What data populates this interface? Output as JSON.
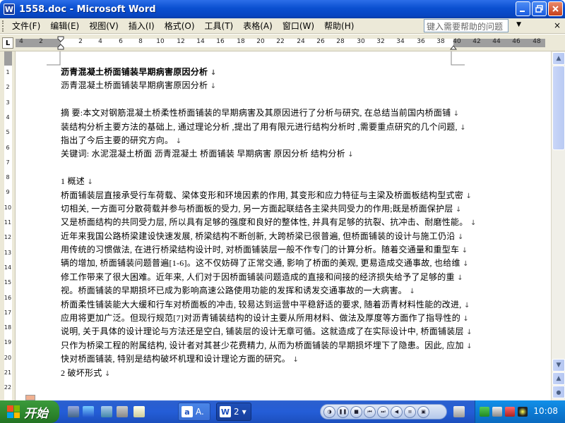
{
  "window": {
    "title": "1558.doc - Microsoft Word",
    "app_icon": "W",
    "buttons": [
      "minimize",
      "maximize",
      "close"
    ]
  },
  "menubar": {
    "items": [
      "文件(F)",
      "编辑(E)",
      "视图(V)",
      "插入(I)",
      "格式(O)",
      "工具(T)",
      "表格(A)",
      "窗口(W)",
      "帮助(H)"
    ],
    "help_placeholder": "键入需要帮助的问题",
    "close_glyph": "×"
  },
  "ruler": {
    "tab_selector": "L",
    "numbers": [
      "4",
      "2",
      "2",
      "4",
      "6",
      "8",
      "10",
      "12",
      "14",
      "16",
      "18",
      "20",
      "22",
      "24",
      "26",
      "28",
      "30",
      "32",
      "34",
      "36",
      "38",
      "40",
      "42",
      "44",
      "46",
      "48"
    ],
    "vertical_numbers": [
      "1",
      "2",
      "3",
      "4",
      "5",
      "6",
      "7",
      "8",
      "9",
      "10",
      "11",
      "12",
      "13",
      "14",
      "15",
      "16",
      "17",
      "18",
      "19",
      "20",
      "21",
      "22"
    ]
  },
  "document": {
    "lines": [
      "沥青混凝土桥面铺装早期病害原因分析",
      "沥青混凝土桥面铺装早期病害原因分析",
      "",
      "摘  要:本文对钢筋混凝土桥柔性桥面铺装的早期病害及其原因进行了分析与研究, 在总结当前国内桥面铺",
      "装结构分析主要方法的基础上, 通过理论分析 ,提出了用有限元进行结构分析时 ,需要重点研究的几个问题,",
      "指出了今后主要的研究方向。",
      "关键词: 水泥混凝土桥面 沥青混凝土 桥面铺装 早期病害 原因分析 结构分析",
      "",
      "1 概述",
      "桥面铺装层直接承受行车荷载、梁体变形和环境因素的作用, 其变形和应力特征与主梁及桥面板结构型式密",
      "切相关, 一方面可分散荷载并参与桥面板的受力, 另一方面起联结各主梁共同受力的作用;既是桥面保护层",
      "又是桥面结构的共同受力层, 所以具有足够的强度和良好的整体性, 并具有足够的抗裂、抗冲击、耐磨性能。",
      "近年来我国公路桥梁建设快速发展, 桥梁结构不断创新, 大跨桥梁已很普遍, 但桥面铺装的设计与施工仍沿",
      "用传统的习惯做法, 在进行桥梁结构设计时, 对桥面铺装层一般不作专门的计算分析。随着交通量和重型车",
      "辆的增加, 桥面铺装问题普遍[1-6]。这不仅妨碍了正常交通, 影响了桥面的美观, 更易造成交通事故, 也给维",
      "修工作带来了很大困难。近年来, 人们对于因桥面铺装问题造成的直接和间接的经济损失给予了足够的重",
      "视。桥面铺装的早期损坏已成为影响高速公路使用功能的发挥和诱发交通事故的一大病害。",
      "桥面柔性铺装能大大缓和行车对桥面板的冲击, 较易达到运营中平稳舒适的要求, 随着沥青材料性能的改进,",
      "应用将更加广泛。但现行规范[7]对沥青铺装结构的设计主要从所用材料、做法及厚度等方面作了指导性的",
      "说明, 关于具体的设计理论与方法还是空白, 铺装层的设计无章可循。这就造成了在实际设计中, 桥面铺装层",
      "只作为桥梁工程的附属结构, 设计者对其甚少花费精力, 从而为桥面铺装的早期损坏埋下了隐患。因此, 应加",
      "快对桥面铺装, 特别是结构破坏机理和设计理论方面的研究。",
      "2 破坏形式"
    ]
  },
  "taskbar": {
    "start_label": "开始",
    "tasks": [
      {
        "icon": "a",
        "label": "A."
      },
      {
        "icon": "W",
        "label": "2"
      }
    ],
    "clock": "10:08"
  }
}
